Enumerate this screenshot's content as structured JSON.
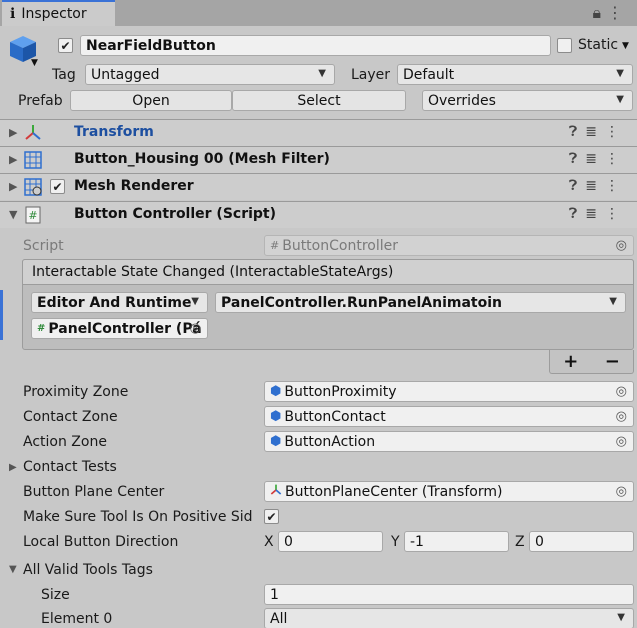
{
  "tab": {
    "icon": "info-icon",
    "title": "Inspector"
  },
  "object": {
    "name": "NearFieldButton",
    "active": true,
    "static_label": "Static"
  },
  "tag": {
    "label": "Tag",
    "value": "Untagged"
  },
  "layer": {
    "label": "Layer",
    "value": "Default"
  },
  "prefab": {
    "label": "Prefab",
    "open": "Open",
    "select": "Select",
    "overrides": "Overrides"
  },
  "components": [
    {
      "title": "Transform"
    },
    {
      "title": "Button_Housing 00 (Mesh Filter)"
    },
    {
      "title": "Mesh Renderer"
    },
    {
      "title": "Button Controller (Script)"
    }
  ],
  "script": {
    "label": "Script",
    "value": "ButtonController"
  },
  "event": {
    "header": "Interactable State Changed (InteractableStateArgs)",
    "mode": "Editor And Runtime",
    "function": "PanelController.RunPanelAnimatoin",
    "target": "PanelController (Pá",
    "plus": "+",
    "minus": "−"
  },
  "fields": {
    "proximity": {
      "label": "Proximity Zone",
      "value": "ButtonProximity"
    },
    "contact": {
      "label": "Contact Zone",
      "value": "ButtonContact"
    },
    "action": {
      "label": "Action Zone",
      "value": "ButtonAction"
    },
    "contact_tests": {
      "label": "Contact Tests"
    },
    "plane_center": {
      "label": "Button Plane Center",
      "value": "ButtonPlaneCenter (Transform)"
    },
    "make_sure": {
      "label": "Make Sure Tool Is On Positive Sid",
      "checked": true
    },
    "direction": {
      "label": "Local Button Direction",
      "x_label": "X",
      "x": "0",
      "y_label": "Y",
      "y": "-1",
      "z_label": "Z",
      "z": "0"
    },
    "valid_tags": {
      "label": "All Valid Tools Tags"
    },
    "size": {
      "label": "Size",
      "value": "1"
    },
    "element0": {
      "label": "Element 0",
      "value": "All"
    }
  }
}
